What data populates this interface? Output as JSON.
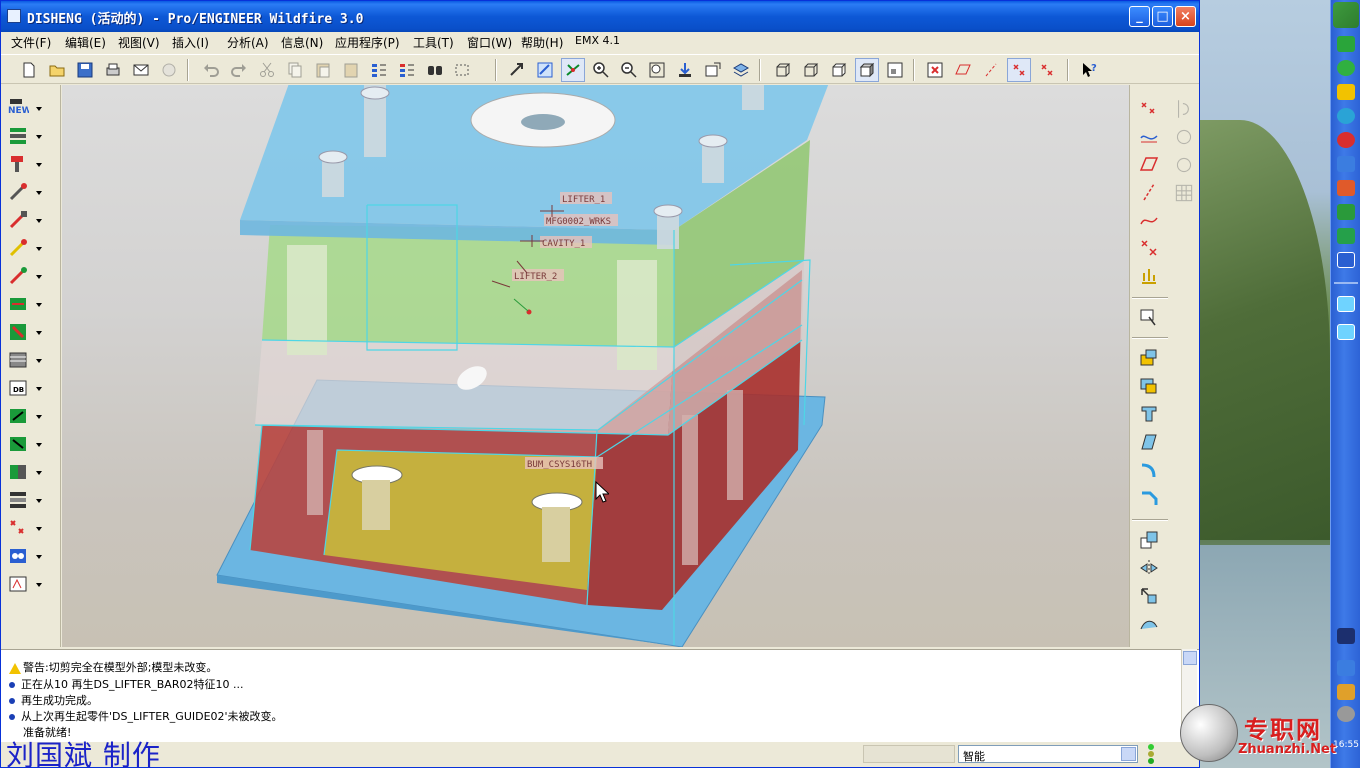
{
  "window": {
    "title": "DISHENG (活动的) - Pro/ENGINEER Wildfire 3.0",
    "minimize": "_",
    "maximize": "□",
    "close": "×"
  },
  "menu": [
    {
      "label": "文件(F)"
    },
    {
      "label": "编辑(E)"
    },
    {
      "label": "视图(V)"
    },
    {
      "label": "插入(I)"
    },
    {
      "label": "分析(A)"
    },
    {
      "label": "信息(N)"
    },
    {
      "label": "应用程序(P)"
    },
    {
      "label": "工具(T)"
    },
    {
      "label": "窗口(W)"
    },
    {
      "label": "帮助(H)"
    },
    {
      "label": "EMX 4.1"
    }
  ],
  "model_labels": {
    "lifter_1": "LIFTER_1",
    "mfg": "MFG0002_WRKS",
    "cavity": "CAVITY_1",
    "lifter_2": "LIFTER_2",
    "bum": "BUM_CSYS16TH"
  },
  "messages": [
    {
      "type": "warning",
      "text": "警告:切剪完全在模型外部;模型未改变。"
    },
    {
      "type": "info",
      "text": "正在从10 再生DS_LIFTER_BAR02特征10 ..."
    },
    {
      "type": "info",
      "text": "再生成功完成。"
    },
    {
      "type": "info",
      "text": "从上次再生起零件'DS_LIFTER_GUIDE02'未被改变。"
    },
    {
      "type": "plain",
      "text": "准备就绪!"
    }
  ],
  "status": {
    "filter_value": "智能",
    "watermark": "刘国斌  制作"
  },
  "logo": {
    "cn": "专职网",
    "en": "Zhuanzhi.Net"
  },
  "tray": {
    "clock": "16:55"
  },
  "colors": {
    "titlebar": "#0a5ae2",
    "mold_top": "#7fc4e8",
    "mold_green": "#a6d98a",
    "mold_red": "#b83a34",
    "mold_yellow": "#c9b53a",
    "mold_base": "#5aaee0"
  }
}
